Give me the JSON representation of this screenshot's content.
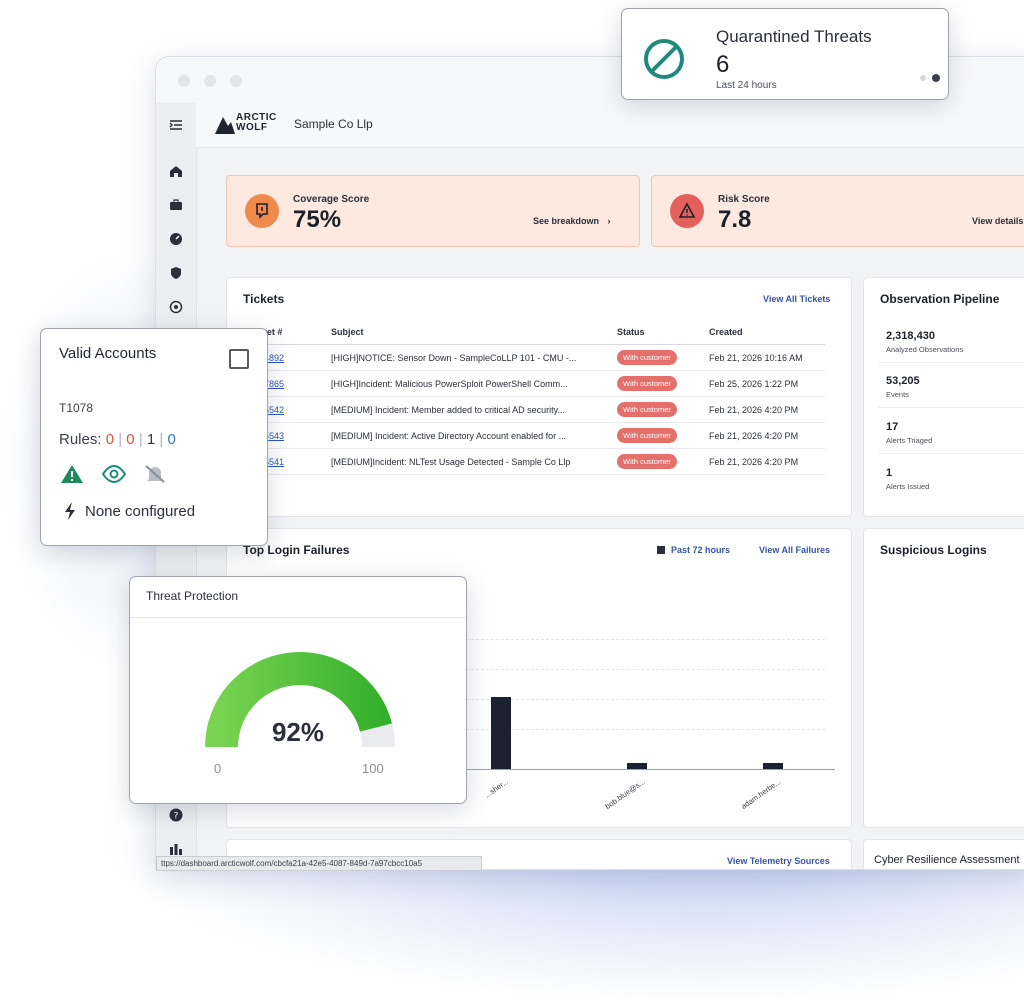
{
  "app": {
    "org_name": "Sample Co Llp",
    "logo_text_line1": "ARCTIC",
    "logo_text_line2": "WOLF",
    "status_url": "ttps://dashboard.arcticwolf.com/cbcfa21a-42e5-4087-849d-7a97cbcc10a5"
  },
  "quarantined": {
    "title": "Quarantined Threats",
    "value": "6",
    "subtitle": "Last 24 hours",
    "icon": "prohibited-icon"
  },
  "coverage": {
    "label": "Coverage Score",
    "value": "75%",
    "link": "See breakdown",
    "icon": "shield-alert-icon",
    "color": "#f08a4b"
  },
  "risk": {
    "label": "Risk Score",
    "value": "7.8",
    "link": "View details",
    "icon": "warning-triangle-icon",
    "color": "#e4605c"
  },
  "tickets": {
    "title": "Tickets",
    "link": "View All Tickets",
    "columns": [
      "Ticket #",
      "Subject",
      "Status",
      "Created"
    ],
    "rows": [
      {
        "num": "6604892",
        "subject": "[HIGH]NOTICE: Sensor Down - SampleCoLLP 101 - CMU -...",
        "status": "With customer",
        "created": "Feb 21, 2026 10:16 AM"
      },
      {
        "num": "6637865",
        "subject": "[HIGH]Incident: Malicious PowerSploit PowerShell Comm...",
        "status": "With customer",
        "created": "Feb 25, 2026 1:22 PM"
      },
      {
        "num": "6605542",
        "subject": "[MEDIUM] Incident: Member added to critical AD security...",
        "status": "With customer",
        "created": "Feb 21, 2026 4:20 PM"
      },
      {
        "num": "6605543",
        "subject": "[MEDIUM] Incident: Active Directory Account enabled for ...",
        "status": "With customer",
        "created": "Feb 21, 2026 4:20 PM"
      },
      {
        "num": "6605541",
        "subject": "[MEDIUM]Incident: NLTest Usage Detected - Sample Co Llp",
        "status": "With customer",
        "created": "Feb 21, 2026 4:20 PM"
      }
    ]
  },
  "observation": {
    "title": "Observation Pipeline",
    "rows": [
      {
        "value": "2,318,430",
        "label": "Analyzed Observations"
      },
      {
        "value": "53,205",
        "label": "Events"
      },
      {
        "value": "17",
        "label": "Alerts Triaged"
      },
      {
        "value": "1",
        "label": "Alerts Issued"
      }
    ]
  },
  "login_failures": {
    "title": "Top Login Failures",
    "range": "Past 72 hours",
    "link": "View All Failures"
  },
  "chart_data": {
    "type": "bar",
    "title": "Top Login Failures",
    "categories": [
      "...sher...",
      "bob.blue@s...",
      "adam.herbe..."
    ],
    "values": [
      38,
      3,
      3
    ],
    "ylim": [
      0,
      100
    ],
    "grid": true
  },
  "suspicious": {
    "title": "Suspicious Logins"
  },
  "telemetry": {
    "link": "View Telemetry Sources"
  },
  "cyber": {
    "title": "Cyber Resilience Assessment"
  },
  "valid_accounts": {
    "title": "Valid Accounts",
    "technique": "T1078",
    "rules_label": "Rules:",
    "rule_counts": [
      "0",
      "0",
      "1",
      "0"
    ],
    "separators": [
      "|",
      "|",
      "|"
    ],
    "config_text": "None configured",
    "rule_colors": [
      "#d9534f",
      "#d9534f",
      "#333333",
      "#2b7bbf"
    ],
    "status_icons": [
      "warning-triangle-icon",
      "eye-icon",
      "bell-off-icon"
    ]
  },
  "threat_protection": {
    "title": "Threat Protection",
    "value_text": "92%",
    "value": 92,
    "min_label": "0",
    "max_label": "100"
  }
}
